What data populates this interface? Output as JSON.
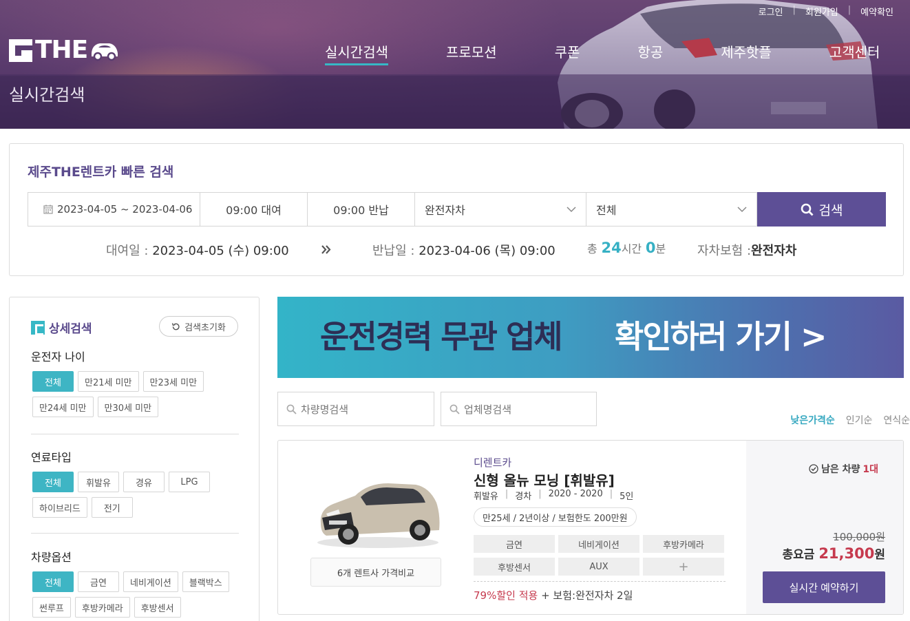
{
  "brand": {
    "logo_text": "THE"
  },
  "top_links": [
    "로그인",
    "회원가입",
    "예약확인"
  ],
  "main_nav": [
    {
      "label": "실시간검색",
      "active": true
    },
    {
      "label": "프로모션"
    },
    {
      "label": "쿠폰"
    },
    {
      "label": "항공"
    },
    {
      "label": "제주핫플"
    },
    {
      "label": "고객센터"
    }
  ],
  "page_title": "실시간검색",
  "quick_search": {
    "title": "제주THE렌트카 빠른 검색",
    "date_range": "2023-04-05 ~ 2023-04-06",
    "pickup_time": "09:00 대여",
    "return_time": "09:00 반납",
    "insurance_select": "완전자차",
    "type_select": "전체",
    "search_label": "검색",
    "summary": {
      "pickup_label": "대여일 :",
      "pickup_value": "2023-04-05 (수)  09:00",
      "return_label": "반납일 :",
      "return_value": "2023-04-06 (목)  09:00",
      "total_prefix": "총",
      "hours": "24",
      "hours_unit": "시간",
      "minutes": "0",
      "minutes_unit": "분",
      "insurance_label": "자차보험 :",
      "insurance_value": "완전자차"
    }
  },
  "sidebar": {
    "title": "상세검색",
    "reset_label": "검색초기화",
    "groups": [
      {
        "title": "운전자 나이",
        "chips": [
          "전체",
          "만21세 미만",
          "만23세 미만",
          "만24세 미만",
          "만30세 미만"
        ]
      },
      {
        "title": "연료타입",
        "chips": [
          "전체",
          "휘발유",
          "경유",
          "LPG",
          "하이브리드",
          "전기"
        ]
      },
      {
        "title": "차량옵션",
        "chips": [
          "전체",
          "금연",
          "네비게이션",
          "블랙박스",
          "썬루프",
          "후방카메라",
          "후방센서"
        ]
      }
    ]
  },
  "banner": {
    "dark_text": "운전경력 무관 업체",
    "light_text": "확인하러 가기 >"
  },
  "filters": {
    "car_name_placeholder": "차량명검색",
    "company_placeholder": "업체명검색",
    "sorts": [
      {
        "label": "낮은가격순",
        "active": true
      },
      {
        "label": "인기순"
      },
      {
        "label": "연식순"
      }
    ]
  },
  "car_card": {
    "company": "디렌트카",
    "model": "신형 올뉴 모닝 [휘발유]",
    "specs": [
      "휘발유",
      "경차",
      "2020 - 2020",
      "5인"
    ],
    "conditions": "만25세 / 2년이상 / 보험한도 200만원",
    "options": [
      "금연",
      "네비게이션",
      "후방카메라",
      "후방센서",
      "AUX",
      "+"
    ],
    "compare_label": "6개 렌트사 가격비교",
    "discount": "79%할인 적용",
    "insurance_note": "+ 보험:완전자차 2일",
    "remaining_label": "남은 차량",
    "remaining_count": "1대",
    "original_price": "100,000원",
    "total_label": "총요금",
    "total_amount": "21,300",
    "total_unit": "원",
    "book_label": "실시간 예약하기"
  },
  "colors": {
    "brand_purple": "#5d4f96",
    "accent_teal": "#3eb5c4",
    "price_red": "#c63a4e"
  }
}
